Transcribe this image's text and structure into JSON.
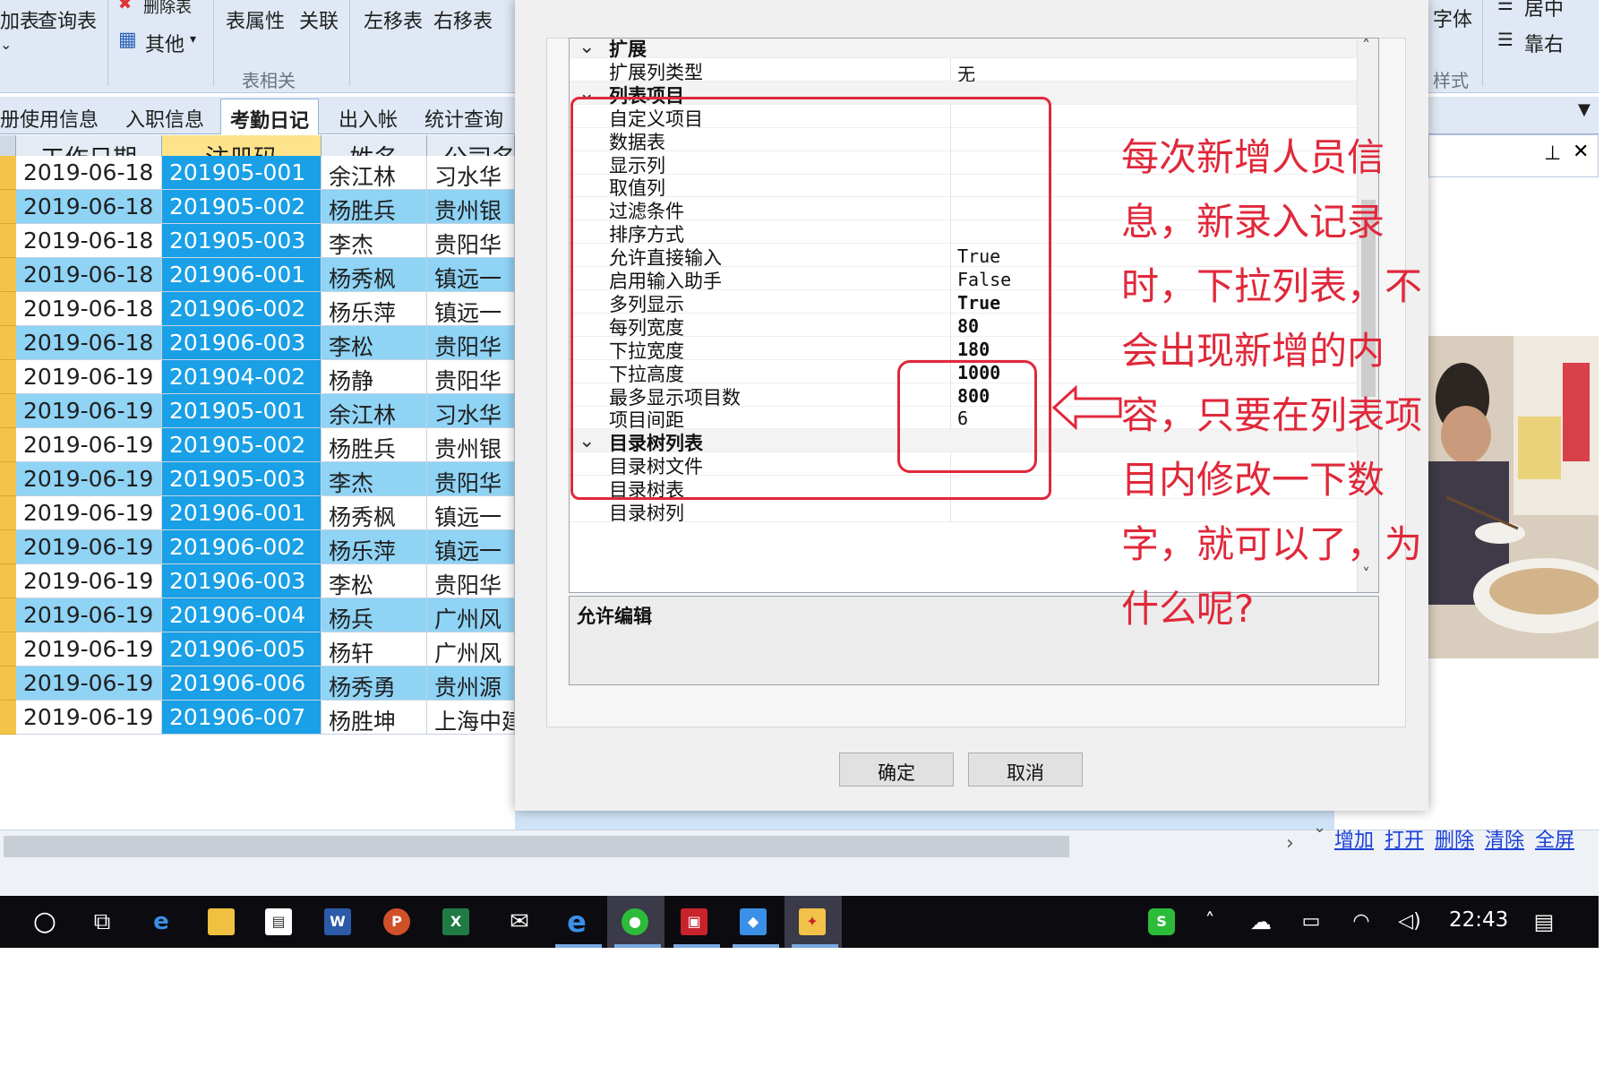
{
  "ribbon": {
    "buttons": {
      "join_table": "加表",
      "query_table": "查询表",
      "delete_table": "删除表",
      "other": "其他",
      "table_props": "表属性",
      "relation": "关联",
      "move_left": "左移表",
      "move_right": "右移表",
      "font": "字体",
      "center": "居中",
      "align_right": "靠右"
    },
    "groups": {
      "table": "表相关",
      "style": "样式"
    }
  },
  "tabs": [
    "册使用信息",
    "入职信息",
    "考勤日记",
    "出入帐",
    "统计查询"
  ],
  "active_tab": "考勤日记",
  "grid": {
    "columns": [
      "工作日期",
      "注册码",
      "姓名",
      "公司名"
    ],
    "rows": [
      [
        "2019-06-18",
        "201905-001",
        "余江林",
        "习水华"
      ],
      [
        "2019-06-18",
        "201905-002",
        "杨胜兵",
        "贵州银"
      ],
      [
        "2019-06-18",
        "201905-003",
        "李杰",
        "贵阳华"
      ],
      [
        "2019-06-18",
        "201906-001",
        "杨秀枫",
        "镇远一"
      ],
      [
        "2019-06-18",
        "201906-002",
        "杨乐萍",
        "镇远一"
      ],
      [
        "2019-06-18",
        "201906-003",
        "李松",
        "贵阳华"
      ],
      [
        "2019-06-19",
        "201904-002",
        "杨静",
        "贵阳华"
      ],
      [
        "2019-06-19",
        "201905-001",
        "余江林",
        "习水华"
      ],
      [
        "2019-06-19",
        "201905-002",
        "杨胜兵",
        "贵州银"
      ],
      [
        "2019-06-19",
        "201905-003",
        "李杰",
        "贵阳华"
      ],
      [
        "2019-06-19",
        "201906-001",
        "杨秀枫",
        "镇远一"
      ],
      [
        "2019-06-19",
        "201906-002",
        "杨乐萍",
        "镇远一"
      ],
      [
        "2019-06-19",
        "201906-003",
        "李松",
        "贵阳华"
      ],
      [
        "2019-06-19",
        "201906-004",
        "杨兵",
        "广州风"
      ],
      [
        "2019-06-19",
        "201906-005",
        "杨轩",
        "广州风"
      ],
      [
        "2019-06-19",
        "201906-006",
        "杨秀勇",
        "贵州源"
      ],
      [
        "2019-06-19",
        "201906-007",
        "杨胜坤",
        "上海中建"
      ]
    ]
  },
  "dialog": {
    "properties": [
      {
        "kind": "category",
        "name": "扩展"
      },
      {
        "kind": "item",
        "name": "扩展列类型",
        "value": "无"
      },
      {
        "kind": "category",
        "name": "列表项目"
      },
      {
        "kind": "item",
        "name": "自定义项目",
        "value": ""
      },
      {
        "kind": "item",
        "name": "数据表",
        "value": ""
      },
      {
        "kind": "item",
        "name": "显示列",
        "value": ""
      },
      {
        "kind": "item",
        "name": "取值列",
        "value": ""
      },
      {
        "kind": "item",
        "name": "过滤条件",
        "value": ""
      },
      {
        "kind": "item",
        "name": "排序方式",
        "value": ""
      },
      {
        "kind": "item",
        "name": "允许直接输入",
        "value": "True"
      },
      {
        "kind": "item",
        "name": "启用输入助手",
        "value": "False"
      },
      {
        "kind": "item",
        "name": "多列显示",
        "value": "True",
        "bold": true
      },
      {
        "kind": "item",
        "name": "每列宽度",
        "value": "80",
        "bold": true
      },
      {
        "kind": "item",
        "name": "下拉宽度",
        "value": "180",
        "bold": true
      },
      {
        "kind": "item",
        "name": "下拉高度",
        "value": "1000",
        "bold": true
      },
      {
        "kind": "item",
        "name": "最多显示项目数",
        "value": "800",
        "bold": true
      },
      {
        "kind": "item",
        "name": "项目间距",
        "value": "6"
      },
      {
        "kind": "category",
        "name": "目录树列表"
      },
      {
        "kind": "item",
        "name": "目录树文件",
        "value": ""
      },
      {
        "kind": "item",
        "name": "目录树表",
        "value": ""
      },
      {
        "kind": "item",
        "name": "目录树列",
        "value": ""
      }
    ],
    "description_title": "允许编辑",
    "ok": "确定",
    "cancel": "取消"
  },
  "annotation": {
    "text": "每次新增人员信息，新录入记录时，下拉列表，不会出现新增的内容，只要在列表项目内修改一下数字，就可以了，为什么呢?",
    "color": "#e0283a"
  },
  "links": [
    "增加",
    "打开",
    "删除",
    "清除",
    "全屏"
  ],
  "taskbar": {
    "time": "22:43",
    "icons": [
      "search-circle-icon",
      "task-view-icon",
      "edge-icon",
      "file-explorer-icon",
      "store-icon",
      "word-icon",
      "powerpoint-icon",
      "excel-icon",
      "mail-icon",
      "ie-icon",
      "wechat-icon",
      "app-red-icon",
      "app-blue-icon",
      "app-active-icon"
    ]
  },
  "colors": {
    "selected_col": "#1aa0e6",
    "alt_row": "#8fd3f5",
    "header_selected": "#ffe38a",
    "annotation": "#e0283a"
  }
}
